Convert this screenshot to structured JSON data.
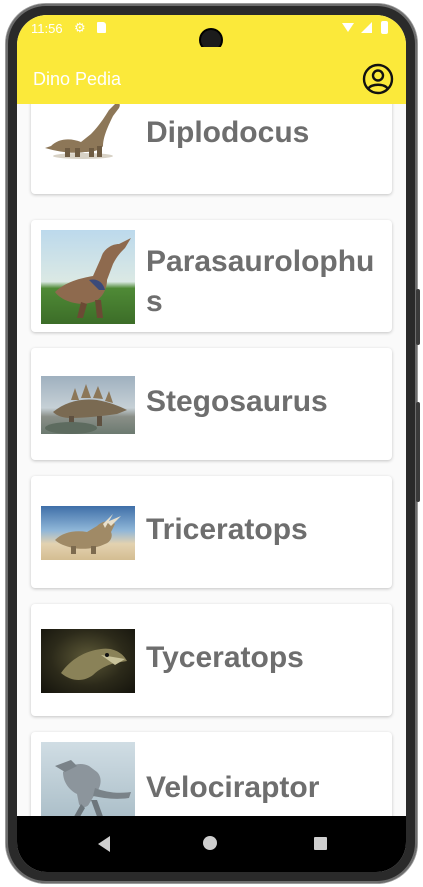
{
  "status_bar": {
    "time": "11:56",
    "icons": [
      "gear-icon",
      "sd-card-icon",
      "wifi-icon",
      "signal-icon",
      "battery-icon"
    ]
  },
  "app_bar": {
    "title": "Dino Pedia",
    "profile_icon": "account-circle-icon"
  },
  "dinosaurs": [
    {
      "name": "Diplodocus"
    },
    {
      "name": "Parasaurolophus"
    },
    {
      "name": "Stegosaurus"
    },
    {
      "name": "Triceratops"
    },
    {
      "name": "Tyceratops"
    },
    {
      "name": "Velociraptor"
    }
  ],
  "nav_bar": {
    "icons": [
      "back-icon",
      "home-icon",
      "recents-icon"
    ]
  },
  "colors": {
    "accent": "#fbe93a",
    "card_text": "#6e6e6e"
  }
}
